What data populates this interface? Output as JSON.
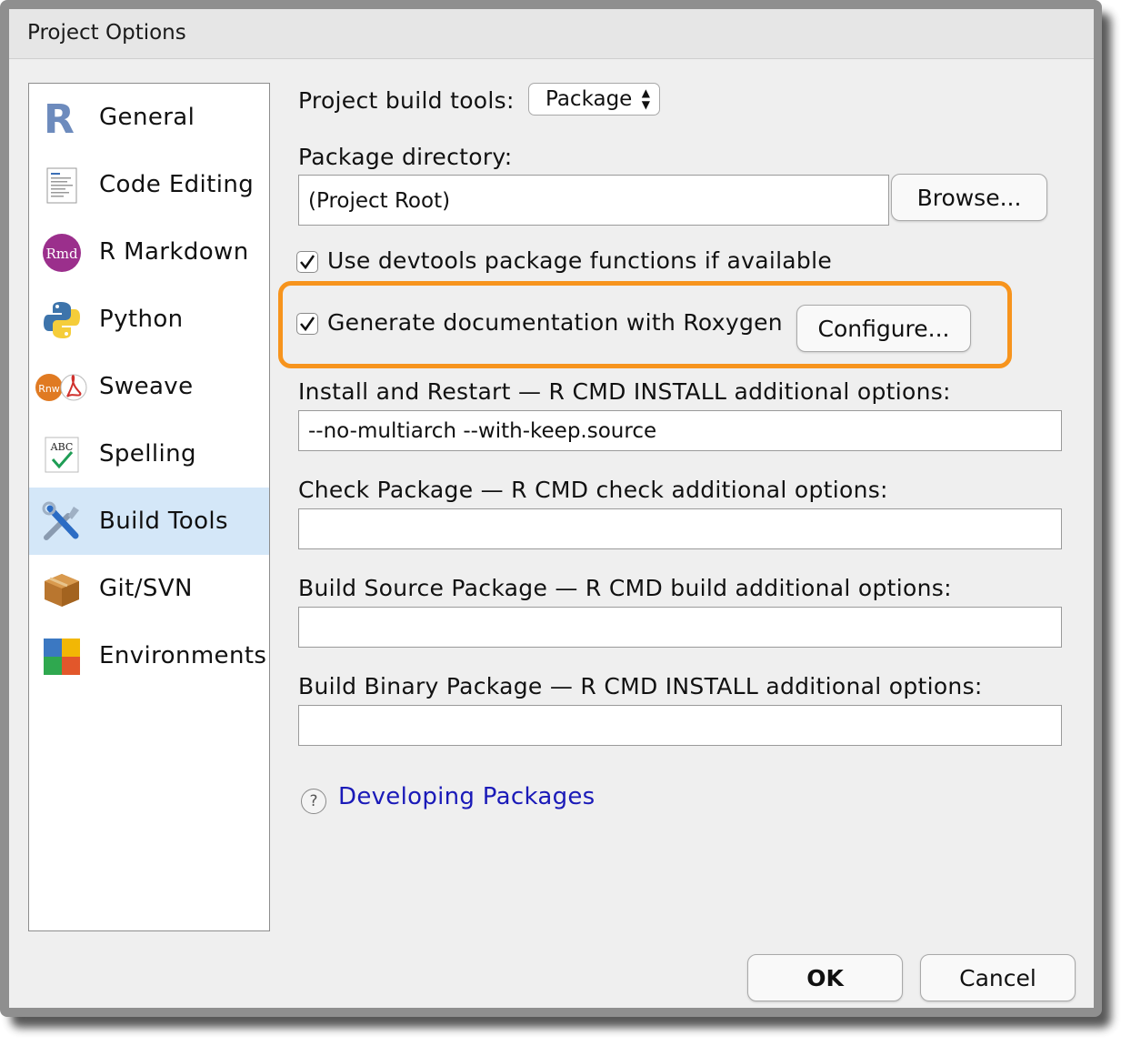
{
  "window": {
    "title": "Project Options"
  },
  "sidebar": {
    "items": [
      {
        "label": "General",
        "icon": "r-logo-icon"
      },
      {
        "label": "Code Editing",
        "icon": "code-document-icon"
      },
      {
        "label": "R Markdown",
        "icon": "rmd-icon"
      },
      {
        "label": "Python",
        "icon": "python-icon"
      },
      {
        "label": "Sweave",
        "icon": "sweave-icon"
      },
      {
        "label": "Spelling",
        "icon": "spelling-icon"
      },
      {
        "label": "Build Tools",
        "icon": "build-tools-icon",
        "selected": true
      },
      {
        "label": "Git/SVN",
        "icon": "git-box-icon"
      },
      {
        "label": "Environments",
        "icon": "environments-icon"
      }
    ]
  },
  "main": {
    "build_tools_label": "Project build tools:",
    "build_tools_value": "Package",
    "package_dir_label": "Package directory:",
    "package_dir_value": "(Project Root)",
    "browse_label": "Browse...",
    "devtools_label": "Use devtools package functions if available",
    "devtools_checked": true,
    "roxygen_label": "Generate documentation with Roxygen",
    "roxygen_checked": true,
    "configure_label": "Configure...",
    "install_label": "Install and Restart — R CMD INSTALL additional options:",
    "install_value": "--no-multiarch --with-keep.source",
    "check_label": "Check Package — R CMD check additional options:",
    "check_value": "",
    "build_source_label": "Build Source Package — R CMD build additional options:",
    "build_source_value": "",
    "build_binary_label": "Build Binary Package — R CMD INSTALL additional options:",
    "build_binary_value": "",
    "help_link": "Developing Packages"
  },
  "footer": {
    "ok_label": "OK",
    "cancel_label": "Cancel"
  },
  "colors": {
    "highlight": "#f7941d",
    "selected_bg": "#d4e7f8",
    "link": "#1a1ab8"
  }
}
